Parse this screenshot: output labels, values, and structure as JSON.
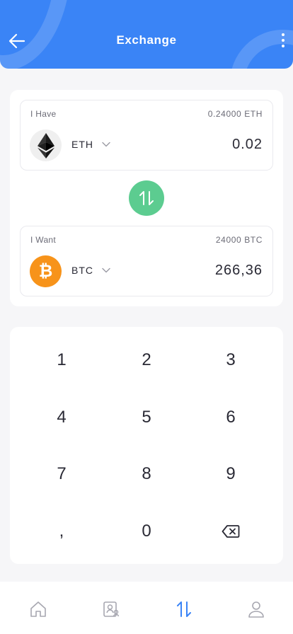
{
  "header": {
    "title": "Exchange",
    "back_icon": "arrow-left-icon",
    "menu_icon": "more-vertical-icon",
    "color": "#3a84f6"
  },
  "have": {
    "label": "I Have",
    "balance": "0.24000 ETH",
    "symbol": "ETH",
    "amount": "0.02",
    "icon": "ethereum-icon"
  },
  "swap": {
    "icon": "swap-arrows-icon",
    "color": "#5ccc90"
  },
  "want": {
    "label": "I Want",
    "balance": "24000 BTC",
    "symbol": "BTC",
    "amount": "266,36",
    "icon": "bitcoin-icon",
    "icon_glyph": "₿",
    "color": "#f7931a"
  },
  "keypad": {
    "keys": [
      "1",
      "2",
      "3",
      "4",
      "5",
      "6",
      "7",
      "8",
      "9",
      ",",
      "0"
    ],
    "backspace_icon": "backspace-icon"
  },
  "nav": {
    "items": [
      "home-icon",
      "wallet-contacts-icon",
      "exchange-icon",
      "profile-icon"
    ],
    "active": "exchange-icon",
    "active_color": "#3a84f6"
  }
}
